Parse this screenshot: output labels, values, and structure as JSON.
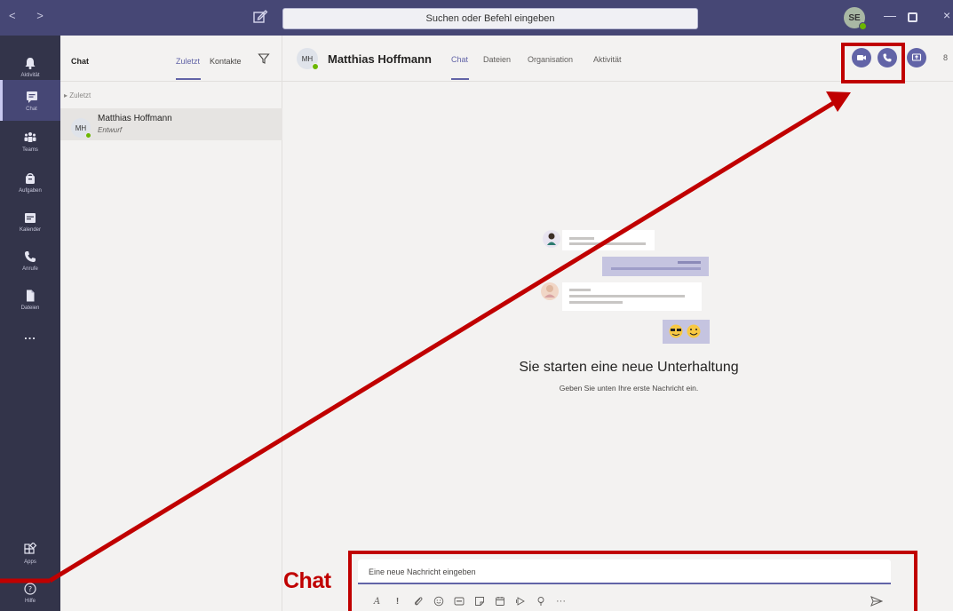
{
  "topbar": {
    "nav_arrows": "< >",
    "search_placeholder": "Suchen oder Befehl eingeben",
    "user_initials": "SE",
    "minimize": "—",
    "close": "×"
  },
  "rail": {
    "items": [
      {
        "label": "Aktivität",
        "icon": "bell-icon"
      },
      {
        "label": "Chat",
        "icon": "chat-icon"
      },
      {
        "label": "Teams",
        "icon": "teams-icon"
      },
      {
        "label": "Aufgaben",
        "icon": "bag-icon"
      },
      {
        "label": "Kalender",
        "icon": "calendar-icon"
      },
      {
        "label": "Anrufe",
        "icon": "phone-icon"
      },
      {
        "label": "Dateien",
        "icon": "file-icon"
      }
    ],
    "more": "...",
    "apps_label": "Apps",
    "help_label": "Hilfe"
  },
  "list": {
    "title": "Chat",
    "tab_recent": "Zuletzt",
    "tab_contacts": "Kontakte",
    "section": "Zuletzt",
    "rows": [
      {
        "initials": "MH",
        "name": "Matthias Hoffmann",
        "status": "Entwurf"
      }
    ]
  },
  "main": {
    "initials": "MH",
    "name": "Matthias Hoffmann",
    "tabs": [
      "Chat",
      "Dateien",
      "Organisation",
      "Aktivität"
    ],
    "empty_title": "Sie starten eine neue Unterhaltung",
    "empty_subtitle": "Geben Sie unten Ihre erste Nachricht ein."
  },
  "compose": {
    "placeholder": "Eine neue Nachricht eingeben",
    "more": "···"
  },
  "annotation": {
    "chat_label": "Chat",
    "color": "#c00000"
  },
  "colors": {
    "accent": "#6264a7",
    "topbar": "#464775",
    "rail": "#33344a",
    "presence": "#6bb700"
  }
}
